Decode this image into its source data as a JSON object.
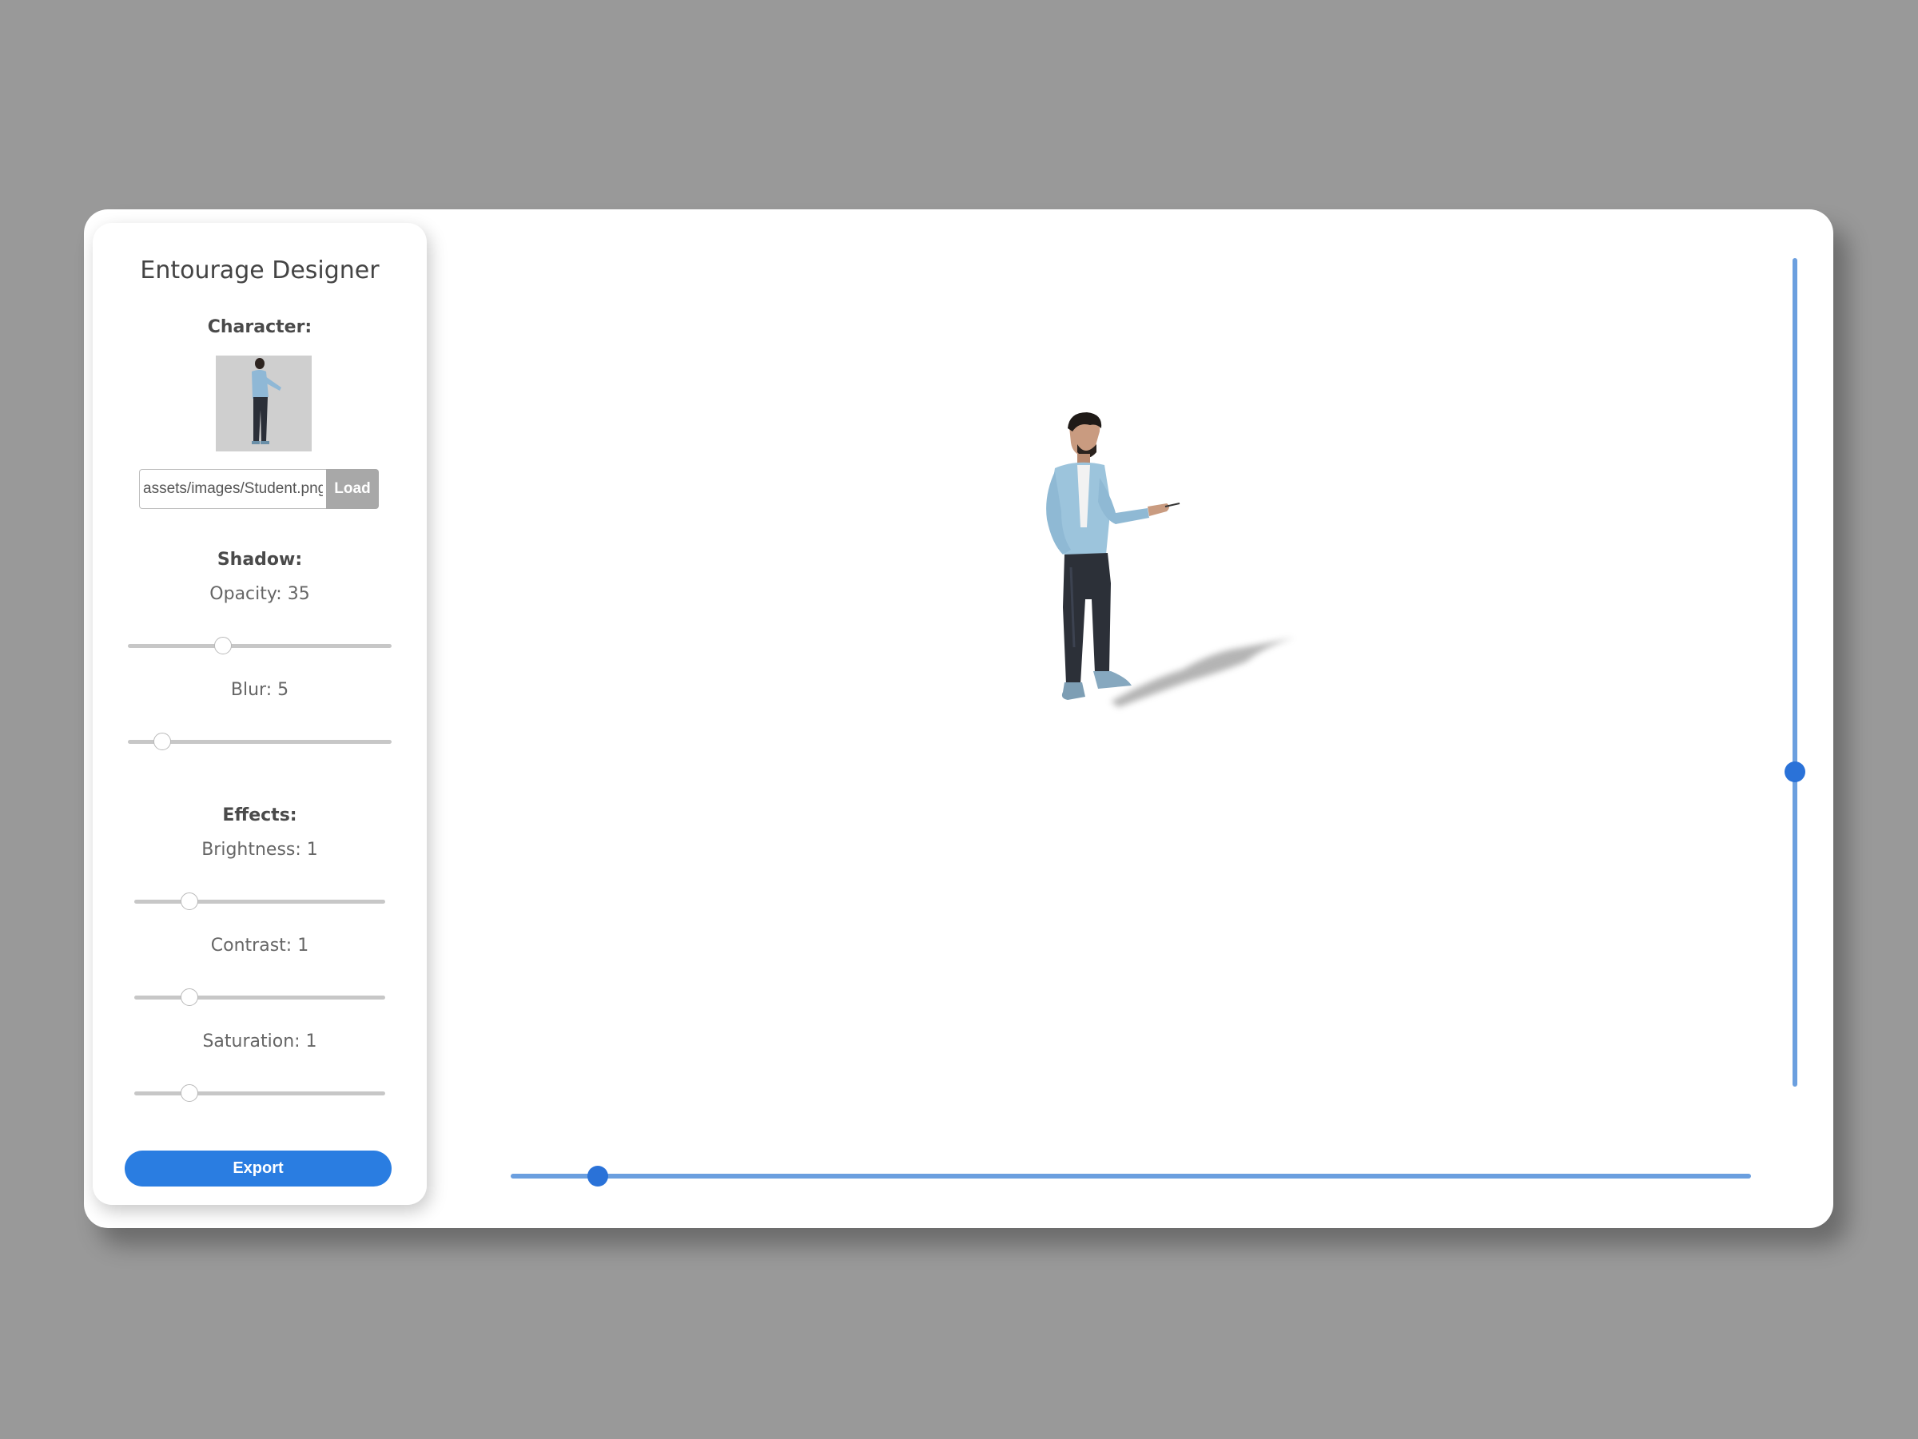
{
  "panel": {
    "title": "Entourage Designer",
    "character_label": "Character:",
    "thumbnail_icon": "person-standing-thumbnail",
    "path_value": "assets/images/Student.png",
    "load_label": "Load",
    "shadow_label": "Shadow:",
    "opacity_text": "Opacity: 35",
    "opacity_value": 35,
    "blur_text": "Blur: 5",
    "blur_value": 5,
    "effects_label": "Effects:",
    "brightness_text": "Brightness: 1",
    "brightness_value": 1,
    "contrast_text": "Contrast: 1",
    "contrast_value": 1,
    "saturation_text": "Saturation: 1",
    "saturation_value": 1,
    "export_label": "Export"
  },
  "canvas": {
    "character_icon": "person-standing-figure",
    "vertical_slider_level": 0.62,
    "horizontal_slider_level": 0.07
  },
  "colors": {
    "background": "#999999",
    "accent": "#2a7de1",
    "slider_track": "#6b9fdf"
  }
}
